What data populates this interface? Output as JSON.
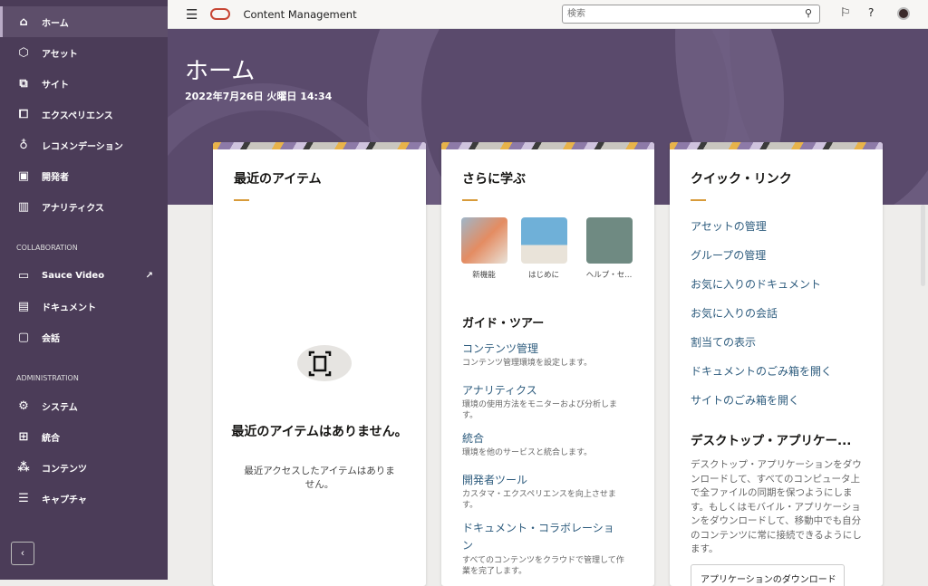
{
  "sidebar": {
    "items": [
      {
        "label": "ホーム",
        "icon": "home-icon",
        "glyph": "⌂",
        "active": true
      },
      {
        "label": "アセット",
        "icon": "cube-icon",
        "glyph": "⬡"
      },
      {
        "label": "サイト",
        "icon": "site-icon",
        "glyph": "⧉"
      },
      {
        "label": "エクスペリエンス",
        "icon": "experience-icon",
        "glyph": "⧠"
      },
      {
        "label": "レコメンデーション",
        "icon": "lightbulb-icon",
        "glyph": "♁"
      },
      {
        "label": "開発者",
        "icon": "code-icon",
        "glyph": "▣"
      },
      {
        "label": "アナリティクス",
        "icon": "chart-icon",
        "glyph": "▥"
      }
    ],
    "collab_label": "COLLABORATION",
    "collab_items": [
      {
        "label": "Sauce Video",
        "icon": "video-icon",
        "glyph": "▭",
        "external": "↗"
      },
      {
        "label": "ドキュメント",
        "icon": "document-icon",
        "glyph": "▤"
      },
      {
        "label": "会話",
        "icon": "conversation-icon",
        "glyph": "▢"
      }
    ],
    "admin_label": "ADMINISTRATION",
    "admin_items": [
      {
        "label": "システム",
        "icon": "gear-icon",
        "glyph": "⚙"
      },
      {
        "label": "統合",
        "icon": "integration-icon",
        "glyph": "⊞"
      },
      {
        "label": "コンテンツ",
        "icon": "content-icon",
        "glyph": "⁂"
      },
      {
        "label": "キャプチャ",
        "icon": "capture-icon",
        "glyph": "☰"
      }
    ],
    "collapse_glyph": "‹"
  },
  "topbar": {
    "menu_glyph": "☰",
    "title": "Content Management",
    "search_placeholder": "検索",
    "search_glyph": "⚲",
    "flag_glyph": "⚐",
    "help_glyph": "⓪"
  },
  "colors": {
    "sidebar": "#4b3c58",
    "banner": "#5a4a6c",
    "accent": "#d89b3a",
    "link": "#2e5c7e",
    "brand": "#c74634"
  },
  "page": {
    "title": "ホーム",
    "date": "2022年7月26日 火曜日 14:34"
  },
  "recent": {
    "title": "最近のアイテム",
    "empty_title": "最近のアイテムはありません。",
    "empty_desc": "最近アクセスしたアイテムはありません。"
  },
  "learn": {
    "title": "さらに学ぶ",
    "thumbs": [
      {
        "caption": "新機能"
      },
      {
        "caption": "はじめに"
      },
      {
        "caption": "ヘルプ・セ..."
      }
    ],
    "guide_title": "ガイド・ツアー",
    "guides": [
      {
        "title": "コンテンツ管理",
        "desc": "コンテンツ管理環境を設定します。"
      },
      {
        "title": "アナリティクス",
        "desc": "環境の使用方法をモニターおよび分析します。"
      },
      {
        "title": "統合",
        "desc": "環境を他のサービスと統合します。"
      },
      {
        "title": "開発者ツール",
        "desc": "カスタマ・エクスペリエンスを向上させます。"
      },
      {
        "title": "ドキュメント・コラボレーション",
        "desc": "すべてのコンテンツをクラウドで管理して作業を完了します。"
      }
    ]
  },
  "quick": {
    "title": "クイック・リンク",
    "links": [
      "アセットの管理",
      "グループの管理",
      "お気に入りのドキュメント",
      "お気に入りの会話",
      "割当ての表示",
      "ドキュメントのごみ箱を開く",
      "サイトのごみ箱を開く"
    ],
    "desktop_title": "デスクトップ・アプリケー...",
    "desktop_desc": "デスクトップ・アプリケーションをダウンロードして、すべてのコンピュータ上で全ファイルの同期を保つようにします。もしくはモバイル・アプリケーションをダウンロードして、移動中でも自分のコンテンツに常に接続できるようにします。",
    "download_label": "アプリケーションのダウンロード"
  }
}
